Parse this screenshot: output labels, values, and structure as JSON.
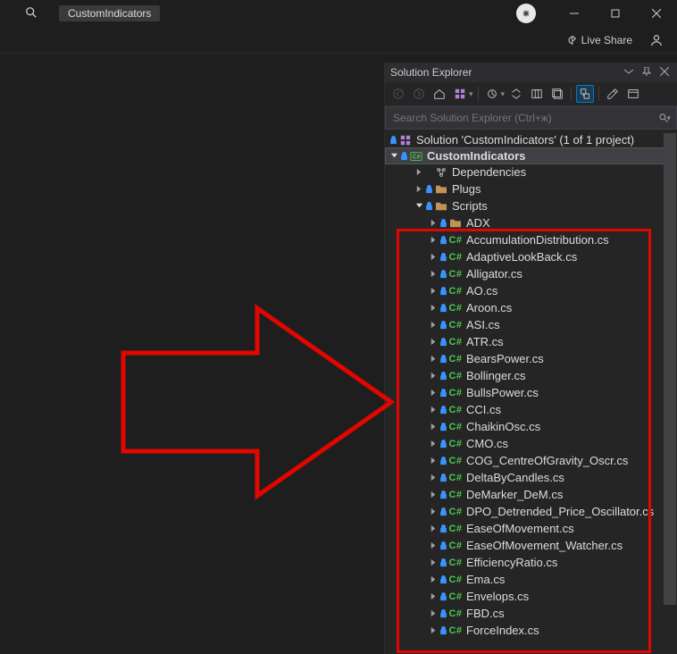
{
  "titlebar": {
    "config_label": "CustomIndicators"
  },
  "toolrow": {
    "live_share_label": "Live Share"
  },
  "panel": {
    "title": "Solution Explorer",
    "search_placeholder": "Search Solution Explorer (Ctrl+ж)",
    "solution_label": "Solution 'CustomIndicators' (1 of 1 project)",
    "project_label": "CustomIndicators",
    "dependencies_label": "Dependencies",
    "folders": {
      "plugs": "Plugs",
      "scripts": "Scripts",
      "adx": "ADX"
    },
    "files": [
      "AccumulationDistribution.cs",
      "AdaptiveLookBack.cs",
      "Alligator.cs",
      "AO.cs",
      "Aroon.cs",
      "ASI.cs",
      "ATR.cs",
      "BearsPower.cs",
      "Bollinger.cs",
      "BullsPower.cs",
      "CCI.cs",
      "ChaikinOsc.cs",
      "CMO.cs",
      "COG_CentreOfGravity_Oscr.cs",
      "DeltaByCandles.cs",
      "DeMarker_DeM.cs",
      "DPO_Detrended_Price_Oscillator.cs",
      "EaseOfMovement.cs",
      "EaseOfMovement_Watcher.cs",
      "EfficiencyRatio.cs",
      "Ema.cs",
      "Envelops.cs",
      "FBD.cs",
      "ForceIndex.cs"
    ]
  }
}
